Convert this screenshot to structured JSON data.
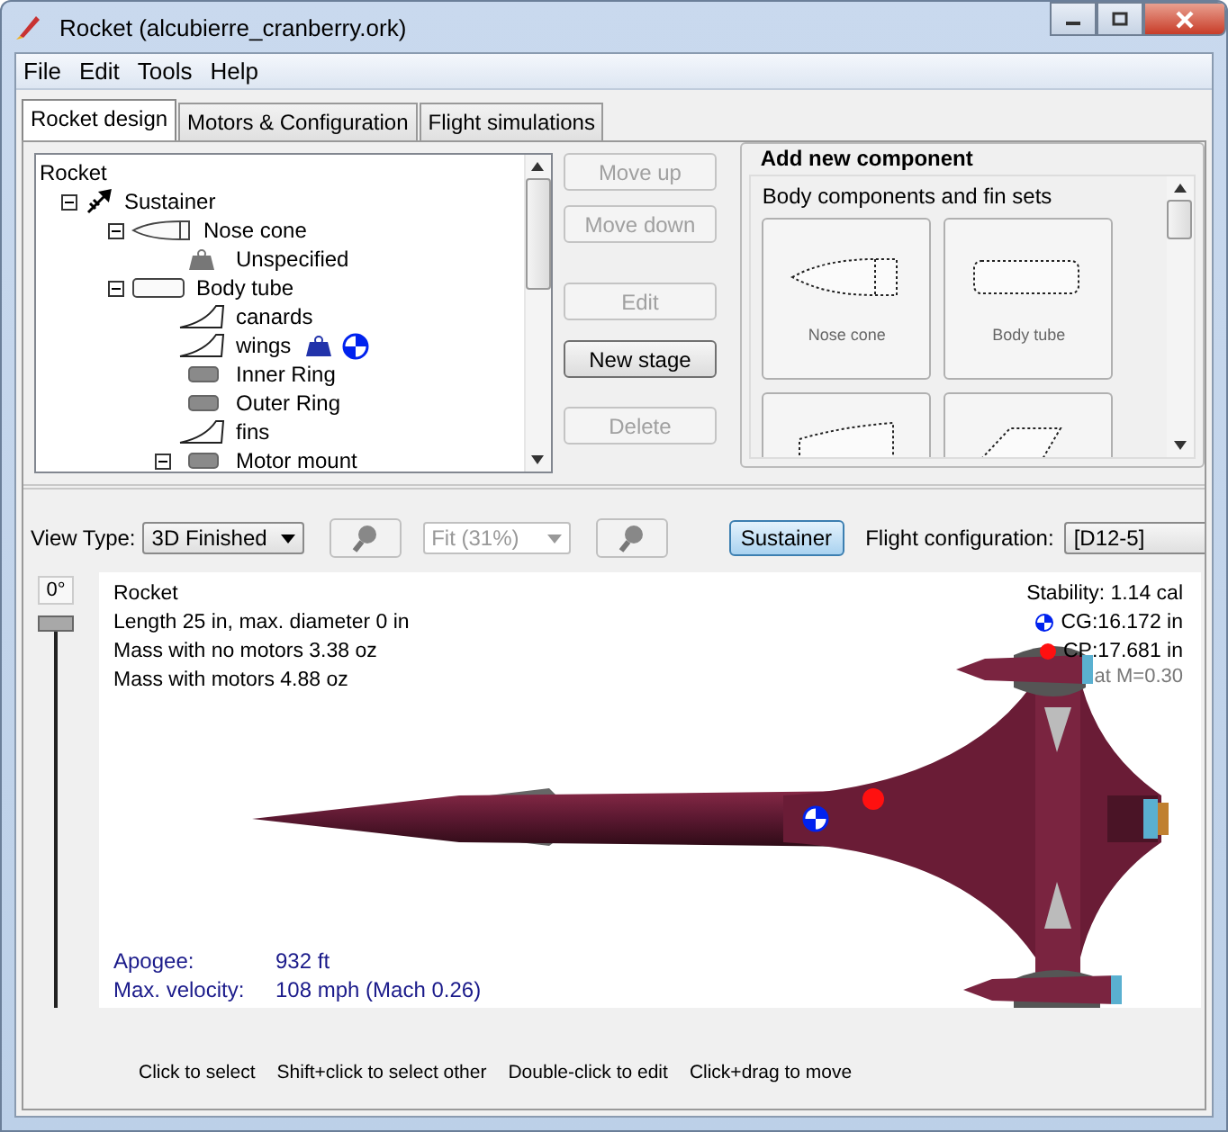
{
  "window": {
    "title": "Rocket (alcubierre_cranberry.ork)"
  },
  "menu": [
    "File",
    "Edit",
    "Tools",
    "Help"
  ],
  "tabs": [
    {
      "label": "Rocket design",
      "selected": true
    },
    {
      "label": "Motors & Configuration",
      "selected": false
    },
    {
      "label": "Flight simulations",
      "selected": false
    }
  ],
  "tree": [
    {
      "label": "Rocket",
      "mass_override": false,
      "cg_override": false,
      "children": [
        {
          "label": "Sustainer",
          "kind": "stage",
          "expanded": true,
          "mass_override": false,
          "cg_override": false,
          "children": [
            {
              "label": "Nose cone",
              "kind": "nose",
              "expanded": true,
              "mass_override": false,
              "cg_override": false,
              "children": [
                {
                  "label": "Unspecified",
                  "kind": "mass",
                  "mass_override": false,
                  "cg_override": false
                }
              ]
            },
            {
              "label": "Body tube",
              "kind": "tube",
              "expanded": true,
              "mass_override": false,
              "cg_override": false,
              "children": [
                {
                  "label": "canards",
                  "kind": "fins",
                  "mass_override": false,
                  "cg_override": false
                },
                {
                  "label": "wings",
                  "kind": "fins",
                  "mass_override": true,
                  "cg_override": true
                },
                {
                  "label": "Inner Ring",
                  "kind": "ring",
                  "mass_override": false,
                  "cg_override": false
                },
                {
                  "label": "Outer Ring",
                  "kind": "ring",
                  "mass_override": false,
                  "cg_override": false
                },
                {
                  "label": "fins",
                  "kind": "fins",
                  "mass_override": false,
                  "cg_override": false
                },
                {
                  "label": "Motor mount",
                  "kind": "ring",
                  "expanded": true,
                  "mass_override": false,
                  "cg_override": false
                }
              ]
            }
          ]
        }
      ]
    }
  ],
  "buttons": [
    {
      "label": "Move up",
      "disabled": true
    },
    {
      "label": "Move down",
      "disabled": true
    },
    {
      "label": "Edit",
      "disabled": true
    },
    {
      "label": "New stage",
      "disabled": false
    },
    {
      "label": "Delete",
      "disabled": true
    }
  ],
  "add_component": {
    "title": "Add new component",
    "section": "Body components and fin sets",
    "tiles": [
      {
        "label": "Nose cone",
        "kind": "nose"
      },
      {
        "label": "Body tube",
        "kind": "tube"
      },
      {
        "kind": "transition"
      },
      {
        "kind": "fins"
      }
    ]
  },
  "toolbar": {
    "view_type_label": "View Type:",
    "view_type": "3D Finished",
    "zoom": "Fit (31%)",
    "zoom_disabled": true,
    "stage": {
      "label": "Sustainer",
      "selected": true
    },
    "config_label": "Flight configuration:",
    "config": "[D12-5]"
  },
  "view": {
    "angle": "0°",
    "rotation": {
      "level": 1
    },
    "info": [
      "Rocket",
      "Length 25 in, max. diameter 0 in",
      "Mass with no motors 3.38 oz",
      "Mass with motors 4.88 oz"
    ],
    "stability": "Stability:  1.14 cal",
    "cg": "CG:16.172 in",
    "cp": "CP:17.681 in",
    "mach": "at M=0.30",
    "flight": [
      {
        "label": "Apogee:",
        "value": "932 ft"
      },
      {
        "label": "Max. velocity:",
        "value": "108 mph  (Mach 0.26)"
      }
    ]
  },
  "hints": [
    "Click to select",
    "Shift+click to select other",
    "Double-click to edit",
    "Click+drag to move"
  ]
}
